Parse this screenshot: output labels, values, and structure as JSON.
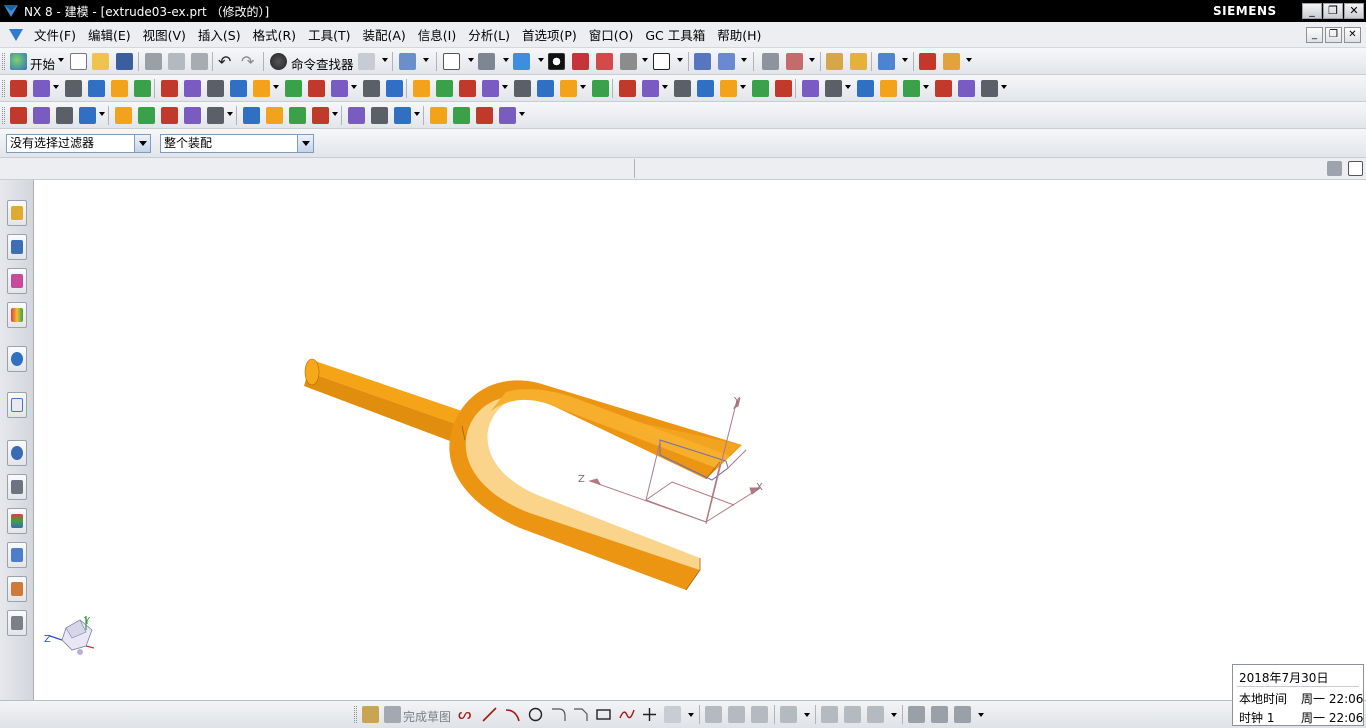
{
  "window": {
    "title": "NX 8 - 建模 - [extrude03-ex.prt （修改的）]",
    "brand": "SIEMENS",
    "controls": [
      "_",
      "❐",
      "✕"
    ]
  },
  "menubar": {
    "items": [
      "文件(F)",
      "编辑(E)",
      "视图(V)",
      "插入(S)",
      "格式(R)",
      "工具(T)",
      "装配(A)",
      "信息(I)",
      "分析(L)",
      "首选项(P)",
      "窗口(O)",
      "GC 工具箱",
      "帮助(H)"
    ],
    "mdi_controls": [
      "_",
      "❐",
      "✕"
    ]
  },
  "toolbar1": {
    "start_label": "开始",
    "command_finder_label": "命令查找器"
  },
  "selection_bar": {
    "type_filter_value": "没有选择过滤器",
    "scope_value": "整个装配"
  },
  "graphics": {
    "triad_labels": {
      "x": "X",
      "y": "Y",
      "z": "Z"
    },
    "view_triad_labels": {
      "y": "Y",
      "z": "Z"
    },
    "part_color": "#F29B11",
    "datum_color": "#B07A82"
  },
  "bottom_toolbar": {
    "finish_sketch_label": "完成草图"
  },
  "clock": {
    "date": "2018年7月30日",
    "local_label": "本地时间",
    "local_value": "周一 22:06",
    "clock1_label": "时钟 1",
    "clock1_value": "周一 22:06"
  },
  "icons": {
    "palette": [
      "#2f6fc4",
      "#f2a21b",
      "#3aa04a",
      "#c0392b",
      "#7a5bc2",
      "#5a5f68"
    ]
  }
}
